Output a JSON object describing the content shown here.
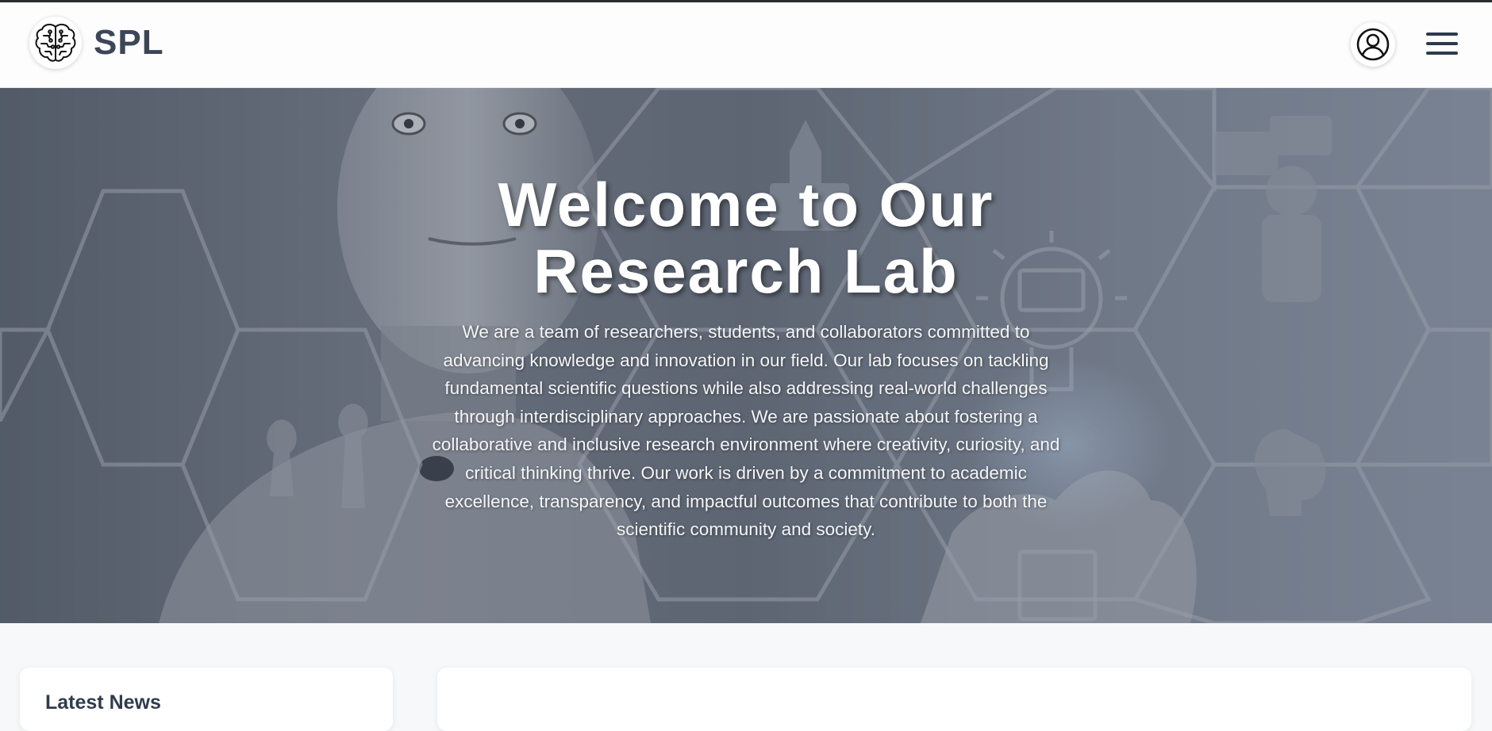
{
  "brand": {
    "name": "SPL",
    "logo_icon": "brain-icon"
  },
  "nav": {
    "profile_icon": "user-circle-icon",
    "menu_icon": "hamburger-menu-icon"
  },
  "hero": {
    "title_line1": "Welcome to Our",
    "title_line2": "Research Lab",
    "description": "We are a team of researchers, students, and collaborators committed to advancing knowledge and innovation in our field. Our lab focuses on tackling fundamental scientific questions while also addressing real-world challenges through interdisciplinary approaches. We are passionate about fostering a collaborative and inclusive research environment where creativity, curiosity, and critical thinking thrive. Our work is driven by a commitment to academic excellence, transparency, and impactful outcomes that contribute to both the scientific community and society."
  },
  "sections": {
    "news_title": "Latest News"
  },
  "colors": {
    "brand_text": "#3c4656",
    "nav_bg": "#fdfdfd",
    "page_bg": "#f6f8fa"
  }
}
